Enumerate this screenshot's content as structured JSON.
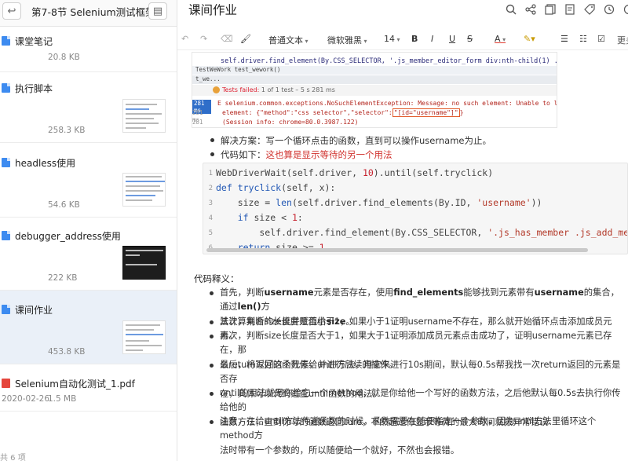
{
  "sidebar": {
    "folder_title": "第7-8节 Selenium测试框架",
    "back_icon": "back-arrow-icon",
    "layout_icon": "layout-toggle-icon",
    "notes": [
      {
        "title": "课堂笔记",
        "meta": "20.8 KB",
        "icon": "note-doc-icon"
      },
      {
        "title": "执行脚本",
        "meta": "258.3 KB",
        "icon": "note-doc-icon"
      },
      {
        "title": "headless使用",
        "meta": "54.6 KB",
        "icon": "note-doc-icon"
      },
      {
        "title": "debugger_address使用",
        "meta": "222 KB",
        "icon": "note-doc-icon"
      },
      {
        "title": "课间作业",
        "meta": "453.8 KB",
        "icon": "note-doc-icon"
      },
      {
        "title": "Selenium自动化测试_1.pdf",
        "date": "2020-02-26",
        "size": "1.5 MB",
        "icon": "pdf-icon"
      }
    ],
    "bottom_text": "共 6 项"
  },
  "editor": {
    "title": "课间作业",
    "top_icons": [
      "search-icon",
      "share-icon",
      "copy-icon",
      "note-icon",
      "tag-icon",
      "clock-icon",
      "info-icon"
    ],
    "toolbar": {
      "paragraph_style": "普通文本",
      "font": "微软雅黑",
      "size": "14",
      "bold": "B",
      "italic": "I",
      "underline": "U",
      "strike": "S",
      "font_color": "A",
      "more": "更多"
    }
  },
  "screenshot_in_doc": {
    "code_line_1": "self.driver.find_element(By.CSS_SELECTOR, '.js_member_editor_form div:nth-child(1) .js_btn_save').clic",
    "tab_1": "TestWeWork   test_wework()",
    "tab_2": "t_we...",
    "fail_prefix": "Tests failed:",
    "fail_rest": " 1 of 1 test – 5 s 281 ms",
    "gutter": [
      "281 ms",
      "281 ms",
      "281 ms",
      "281 ms"
    ],
    "error_1": "E       selenium.common.exceptions.NoSuchElementException: Message: no such element: Unable to locate",
    "error_2a": "element: {\"method\":\"css selector\",\"selector\":",
    "error_2b": "\"[id=\"username\"]\"",
    "error_2c": "}",
    "error_3": "        (Session info: chrome=80.0.3987.122)"
  },
  "bullets": {
    "b1": "解决方案：写一个循环点击的函数，直到可以操作username为止。",
    "b2_label": "代码如下：",
    "b2_red": "这也算是显示等待的另一个用法"
  },
  "code": {
    "lines": [
      "1",
      "2",
      "3",
      "4",
      "5",
      "6"
    ]
  },
  "explanation": {
    "label": "代码释义：",
    "p1a": "首先，判断",
    "p1b": "username",
    "p1c": "元素是否存在，使用",
    "p1d": "find_elements",
    "p1e": "能够找到元素带有",
    "p1f": "username",
    "p1g": "的集合，通过",
    "p1h": "len()",
    "p1i": "方",
    "p1j": "法计算集合的长度并赋值给",
    "p1k": "size",
    "p1l": "。",
    "p2": "其次，判断size长度是否小于1，如果小于1证明username不存在，那么就开始循环点击添加成员元素。",
    "p3a": "再次，判断size长度是否大于1，如果大于1证明添加成员元素点击成功了，证明username元素已存在，那",
    "p3b": "么return返回这个元素，并进行后续的操作。",
    "p4a": "最后，将写好的函数传给until方法，用它来进行10s期间，默认每0.5s帮我找一次return返回的元素是否存",
    "p4b": "在，具体可以代码追查until函数的用法。",
    "p5a": "until的用法就是你给它一个method，就是你给他一个写好的函数方法，之后他默认每0.5s去执行你传给他的",
    "p5b": "函数方法，直到你写的函数返回ture，不然超过你显示等待的最大时间就报异常错误",
    "p6a": "注意，在给until方法传递函数的时候，函数需要在随便指定一个参数，因为until方法里循环这个method方",
    "p6b": "法时带有一个参数的，所以随便给一个就好，不然也会报错。"
  }
}
